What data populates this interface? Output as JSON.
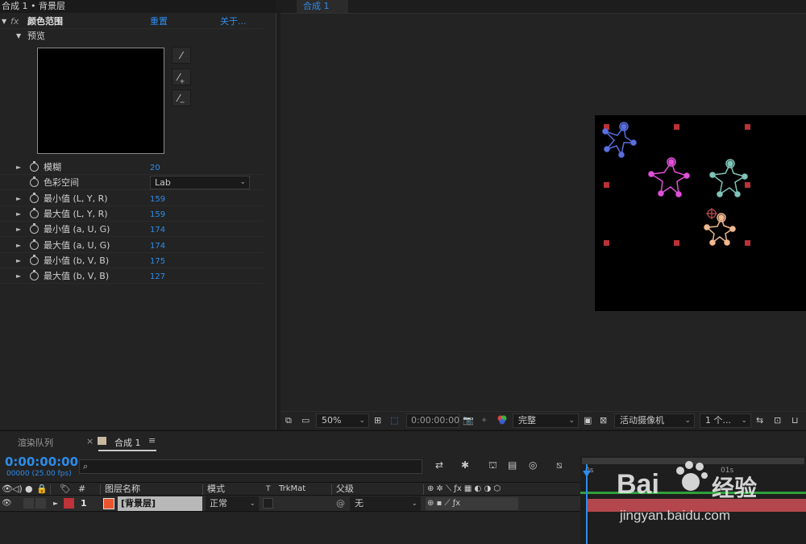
{
  "effect_panel": {
    "header_title": "合成 1 • 背景层",
    "fx_icon": "fx",
    "effect_name": "颜色范围",
    "reset_label": "重置",
    "about_label": "关于...",
    "preview_label": "预览",
    "colorspace_label": "色彩空间",
    "colorspace_value": "Lab",
    "params": [
      {
        "label": "模糊",
        "value": "20"
      },
      {
        "label": "最小值 (L, Y, R)",
        "value": "159"
      },
      {
        "label": "最大值 (L, Y, R)",
        "value": "159"
      },
      {
        "label": "最小值 (a, U, G)",
        "value": "174"
      },
      {
        "label": "最大值 (a, U, G)",
        "value": "174"
      },
      {
        "label": "最小值 (b, V, B)",
        "value": "175"
      },
      {
        "label": "最大值 (b, V, B)",
        "value": "127"
      }
    ]
  },
  "viewer": {
    "tab_label": "合成 1",
    "zoom": "50%",
    "timecode": "0:00:00:00",
    "resolution": "完整",
    "camera": "活动摄像机",
    "views": "1 个..."
  },
  "timeline": {
    "tab_render_queue": "渲染队列",
    "tab_comp": "合成 1",
    "current_time": "0:00:00:00",
    "fps_label": "00000 (25.00 fps)",
    "search_placeholder": "",
    "ruler_start": "0s",
    "ruler_01s": "01s",
    "columns": {
      "hash": "#",
      "layer_name": "图层名称",
      "mode": "模式",
      "t": "T",
      "trkmat": "TrkMat",
      "parent": "父级"
    },
    "layer": {
      "number": "1",
      "name": "[背景层]",
      "mode": "正常",
      "parent": "无"
    }
  },
  "watermark": {
    "brand": "Bai",
    "brand2": "经验",
    "url": "jingyan.baidu.com"
  },
  "colors": {
    "accent_blue": "#2d8ceb",
    "layer_label_red": "#c0333a",
    "layer_color_orange": "#e8552f",
    "track_bar": "#b4474d"
  }
}
